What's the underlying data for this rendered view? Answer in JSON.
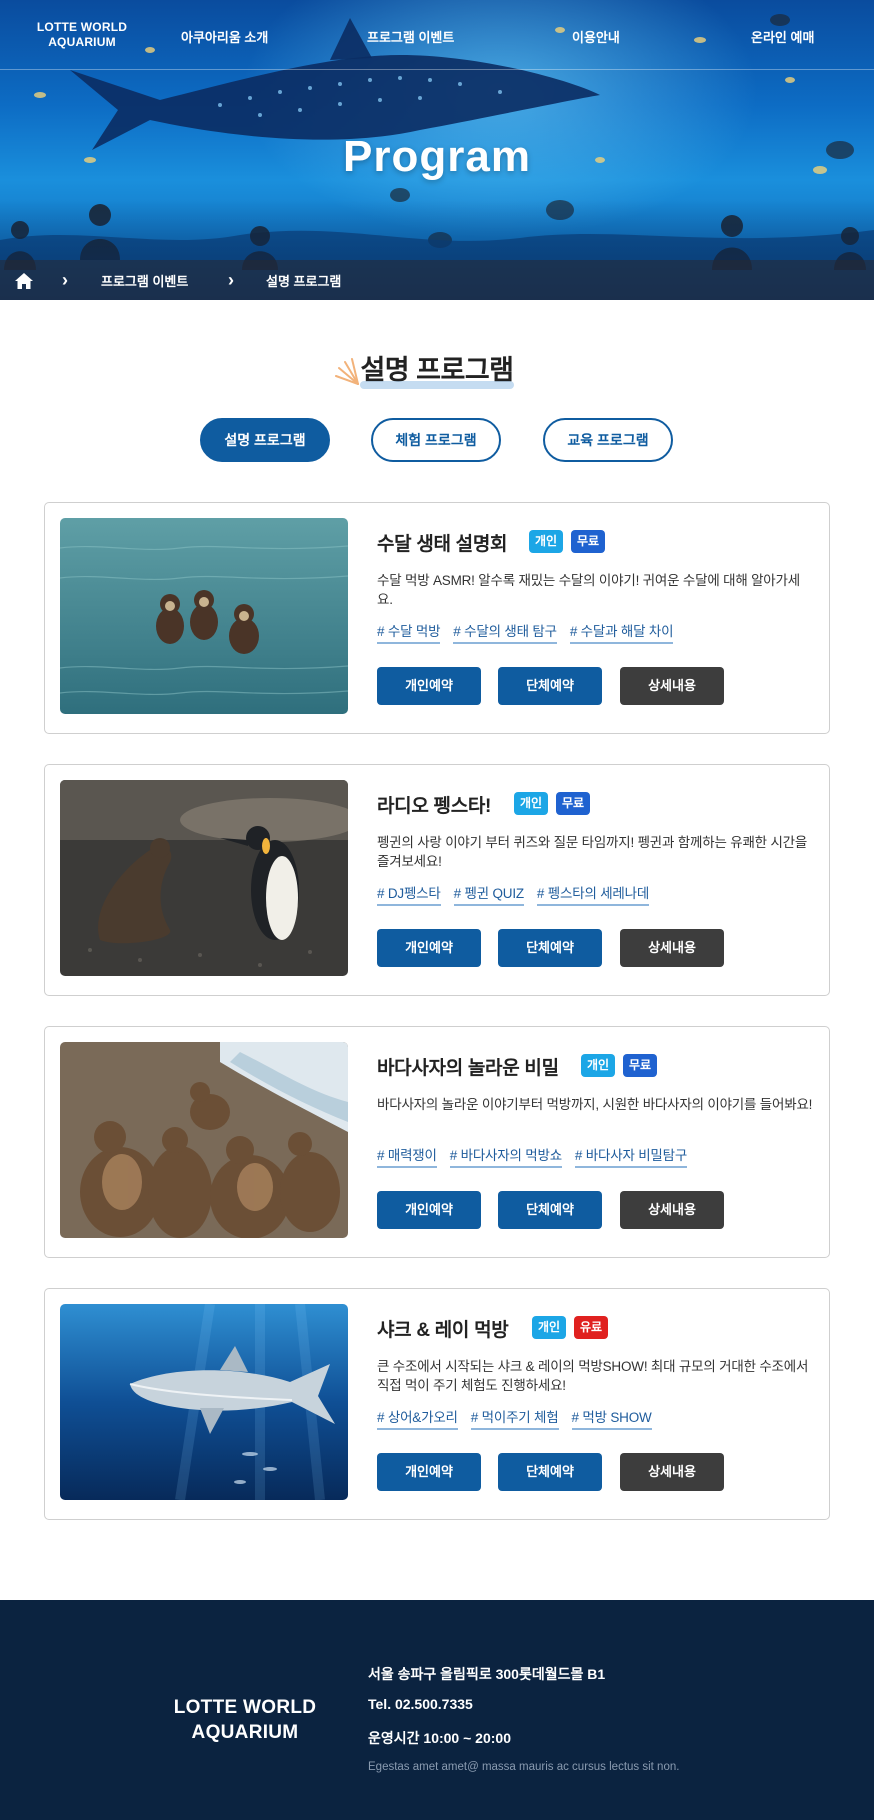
{
  "header": {
    "logo_line1": "LOTTE WORLD",
    "logo_line2": "AQUARIUM",
    "nav": [
      "아쿠아리움 소개",
      "프로그램 이벤트",
      "이용안내",
      "온라인 예매"
    ],
    "hero_title": "Program",
    "breadcrumb": [
      "프로그램 이벤트",
      "설명 프로그램"
    ]
  },
  "section": {
    "title": "설명 프로그램",
    "tabs": [
      {
        "label": "설명 프로그램",
        "active": true
      },
      {
        "label": "체험 프로그램",
        "active": false
      },
      {
        "label": "교육 프로그램",
        "active": false
      }
    ]
  },
  "buttons": {
    "personal": "개인예약",
    "group": "단체예약",
    "detail": "상세내용"
  },
  "programs": [
    {
      "title": "수달 생태 설명회",
      "badge_type": "개인",
      "badge_price": "무료",
      "description": "수달 먹방 ASMR! 알수록 재밌는 수달의 이야기! 귀여운 수달에 대해 알아가세요.",
      "tags": [
        "# 수달 먹방",
        "# 수달의 생태 탐구",
        "# 수달과 해달 차이"
      ]
    },
    {
      "title": "라디오 펭스타!",
      "badge_type": "개인",
      "badge_price": "무료",
      "description": "펭귄의 사랑 이야기 부터 퀴즈와 질문 타임까지! 펭귄과 함께하는 유쾌한 시간을 즐겨보세요!",
      "tags": [
        "# DJ펭스타",
        "# 펭귄 QUIZ",
        "# 펭스타의 세레나데"
      ]
    },
    {
      "title": "바다사자의 놀라운 비밀",
      "badge_type": "개인",
      "badge_price": "무료",
      "description": "바다사자의 놀라운 이야기부터 먹방까지, 시원한 바다사자의 이야기를 들어봐요!",
      "tags": [
        "# 매력쟁이",
        "# 바다사자의 먹방쇼",
        "# 바다사자 비밀탐구"
      ]
    },
    {
      "title": "샤크 & 레이 먹방",
      "badge_type": "개인",
      "badge_price": "유료",
      "description": "큰 수조에서 시작되는 샤크 & 레이의 먹방SHOW! 최대 규모의 거대한 수조에서 직접 먹이 주기 체험도 진행하세요!",
      "tags": [
        "# 상어&가오리",
        "# 먹이주기 체험",
        "# 먹방 SHOW"
      ]
    }
  ],
  "footer": {
    "logo_line1": "LOTTE WORLD",
    "logo_line2": "AQUARIUM",
    "address": "서울 송파구 올림픽로 300롯데월드몰 B1",
    "tel": "Tel. 02.500.7335",
    "hours": "운영시간 10:00 ~ 20:00",
    "note": "Egestas amet amet@ massa mauris ac cursus lectus sit non."
  },
  "colors": {
    "primary": "#0f5ca0",
    "dark_button": "#3d3d3d",
    "badge_personal": "#1ca6e6",
    "badge_free": "#1f62d0",
    "badge_paid": "#e0211f",
    "footer_bg": "#0b2340"
  }
}
